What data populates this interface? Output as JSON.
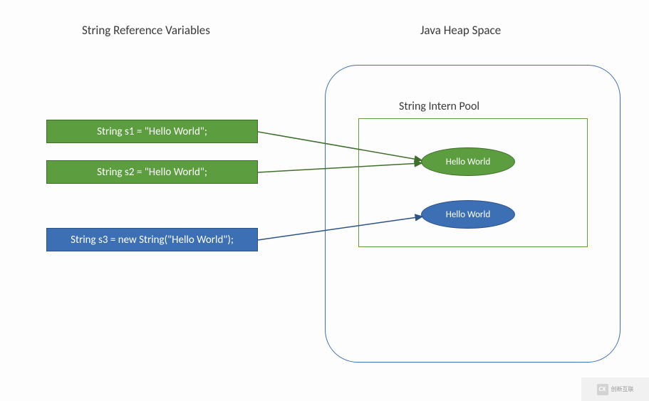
{
  "titles": {
    "left": "String Reference  Variables",
    "right": "Java Heap Space"
  },
  "refs": {
    "s1": "String s1 = \"Hello World\";",
    "s2": "String s2 = \"Hello World\";",
    "s3": "String s3 = new String(\"Hello World\");"
  },
  "heap": {
    "pool_label": "String Intern Pool",
    "obj1": "Hello World",
    "obj2": "Hello World"
  },
  "colors": {
    "green": "#5b9d3f",
    "green_border": "#406f2d",
    "blue": "#3d6fb4",
    "blue_border": "#2d5288"
  },
  "watermark": {
    "logo": "CX",
    "text": "创新互联"
  }
}
